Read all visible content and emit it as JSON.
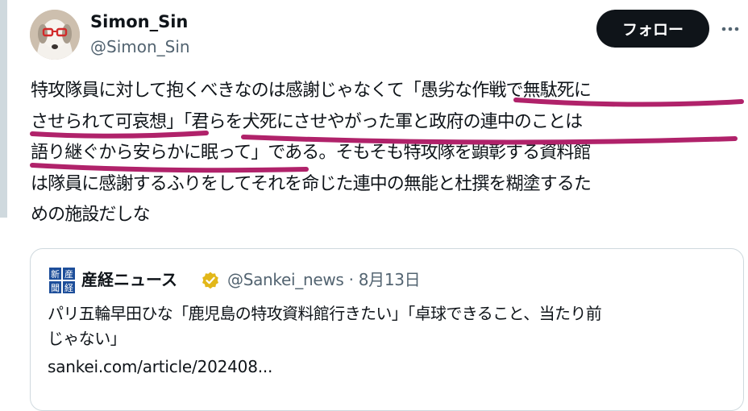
{
  "author": {
    "name": "Simon_Sin",
    "handle": "@Simon_Sin",
    "avatar_icon": "dog-with-red-glasses-avatar"
  },
  "follow_button": {
    "label": "フォロー"
  },
  "more_icon": "ellipsis-icon",
  "tweet": {
    "lines": [
      "特攻隊員に対して抱くべきなのは感謝じゃなくて「愚劣な作戦で無駄死に",
      "させられて可哀想」「君らを犬死にさせやがった軍と政府の連中のことは",
      "語り継ぐから安らかに眠って」である。そもそも特攻隊を顕彰する資料館",
      "は隊員に感謝するふりをしてそれを命じた連中の無能と杜撰を糊塗するた",
      "めの施設だしな"
    ]
  },
  "quote": {
    "logo_icon": "sankei-shimbun-logo",
    "logo_text": "産経新聞",
    "name": "産経ニュース",
    "verified_icon": "gold-verified-badge-icon",
    "handle": "@Sankei_news",
    "separator": "·",
    "date": "8月13日",
    "text_lines": [
      "パリ五輪早田ひな「鹿児島の特攻資料館行きたい」「卓球できること、当たり前",
      "じゃない」"
    ],
    "link": "sankei.com/article/202408..."
  },
  "colors": {
    "text": "#0f1419",
    "secondary": "#536471",
    "border": "#cfd9de",
    "button_bg": "#0f1419",
    "button_text": "#ffffff",
    "underline_annotation": "#b0226a",
    "verified_gold": "#e2b719"
  }
}
